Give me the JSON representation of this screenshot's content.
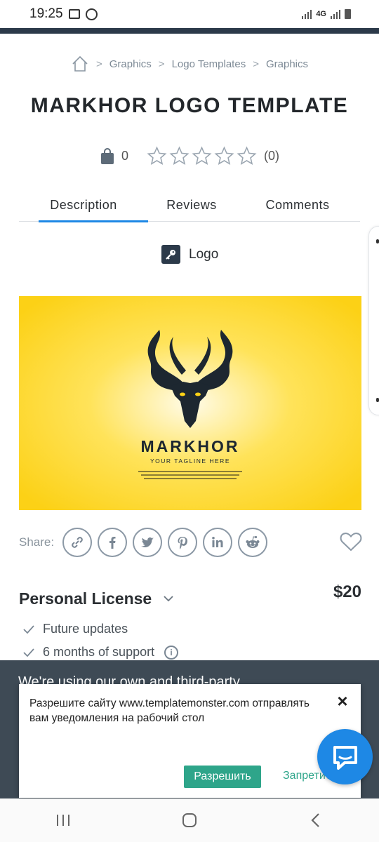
{
  "status_bar": {
    "time": "19:25",
    "network": "4G",
    "icons": [
      "gallery-icon",
      "whatsapp-icon",
      "signal-icon",
      "battery-icon"
    ]
  },
  "breadcrumb": {
    "home_icon": "home-icon",
    "items": [
      "Graphics",
      "Logo Templates",
      "Graphics"
    ]
  },
  "product": {
    "title": "MARKHOR LOGO TEMPLATE",
    "sales_count": "0",
    "rating": 0,
    "rating_count": "(0)",
    "category": "Logo"
  },
  "tabs": [
    "Description",
    "Reviews",
    "Comments"
  ],
  "active_tab": "Description",
  "preview": {
    "brand": "MARKHOR",
    "tagline": "YOUR TAGLINE HERE",
    "background_color": "#fcd116"
  },
  "share": {
    "label": "Share:",
    "buttons": [
      "link-icon",
      "facebook-icon",
      "twitter-icon",
      "pinterest-icon",
      "linkedin-icon",
      "reddit-icon"
    ]
  },
  "license": {
    "name": "Personal License",
    "price": "$20",
    "features": [
      "Future updates",
      "6 months of support"
    ]
  },
  "cookie_bar": {
    "text": "We're using our own and third-party"
  },
  "notification_dialog": {
    "message": "Разрешите сайту www.templatemonster.com отправлять вам уведомления на рабочий стол",
    "allow_label": "Разрешить",
    "deny_label": "Запретить"
  },
  "colors": {
    "accent_blue": "#1e88e5",
    "allow_green": "#2ea58a",
    "dark_header": "#2c3a4a"
  }
}
